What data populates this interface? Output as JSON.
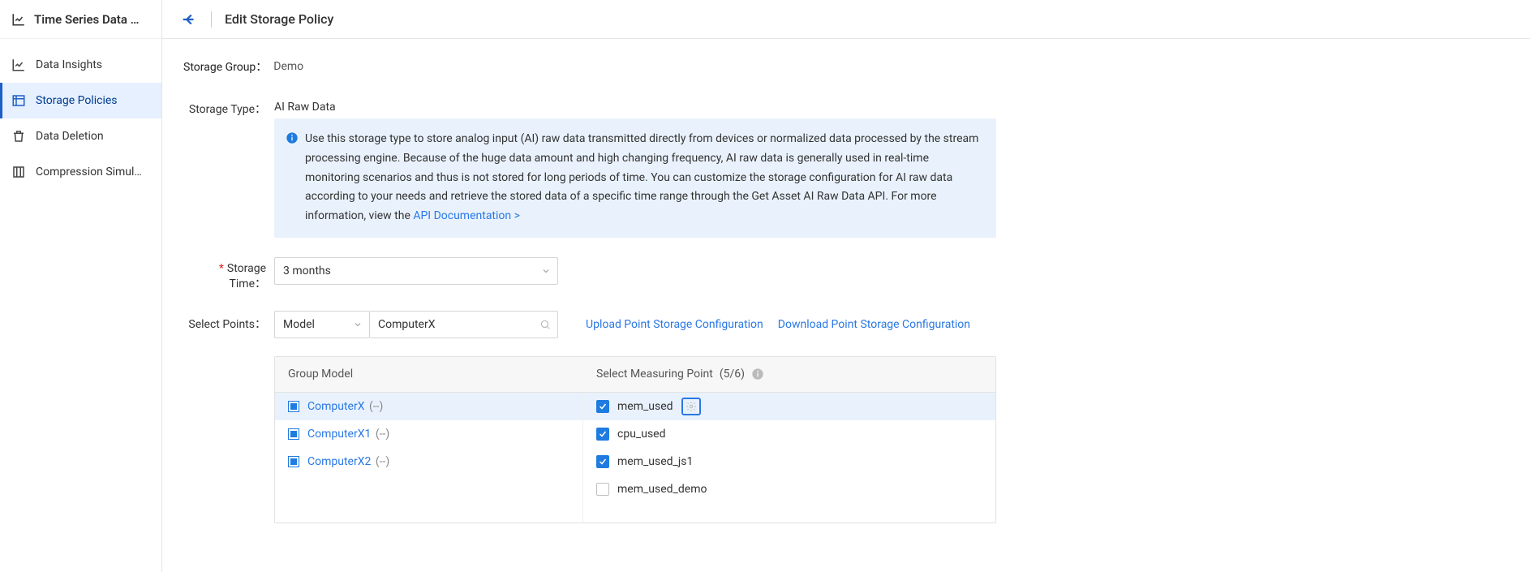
{
  "sidebar": {
    "title": "Time Series Data …",
    "items": [
      {
        "label": "Data Insights",
        "icon": "chart"
      },
      {
        "label": "Storage Policies",
        "icon": "list",
        "active": true
      },
      {
        "label": "Data Deletion",
        "icon": "trash"
      },
      {
        "label": "Compression Simul…",
        "icon": "compress"
      }
    ]
  },
  "page": {
    "title": "Edit Storage Policy",
    "storage_group_label": "Storage Group：",
    "storage_group_value": "Demo",
    "storage_type_label": "Storage Type：",
    "storage_type_value": "AI Raw Data",
    "info_text": "Use this storage type to store analog input (AI) raw data transmitted directly from devices or normalized data processed by the stream processing engine. Because of the huge data amount and high changing frequency, AI raw data is generally used in real-time monitoring scenarios and thus is not stored for long periods of time. You can customize the storage configuration for AI raw data according to your needs and retrieve the stored data of a specific time range through the Get Asset AI Raw Data API. For more information, view the ",
    "info_link": "API Documentation >",
    "storage_time_label": "Storage Time：",
    "storage_time_value": "3 months",
    "select_points_label": "Select Points：",
    "model_select_label": "Model",
    "search_value": "ComputerX",
    "upload_link": "Upload Point Storage Configuration",
    "download_link": "Download Point Storage Configuration",
    "table": {
      "col_group": "Group Model",
      "col_points_prefix": "Select Measuring Point ",
      "col_points_count": "(5/6)",
      "groups": [
        {
          "name": "ComputerX",
          "suffix": " (--)",
          "selected": true
        },
        {
          "name": "ComputerX1",
          "suffix": " (--)"
        },
        {
          "name": "ComputerX2",
          "suffix": " (--)"
        }
      ],
      "points": [
        {
          "name": "mem_used",
          "checked": true,
          "highlight": true,
          "gear": true
        },
        {
          "name": "cpu_used",
          "checked": true
        },
        {
          "name": "mem_used_js1",
          "checked": true
        },
        {
          "name": "mem_used_demo",
          "checked": false
        }
      ]
    }
  }
}
